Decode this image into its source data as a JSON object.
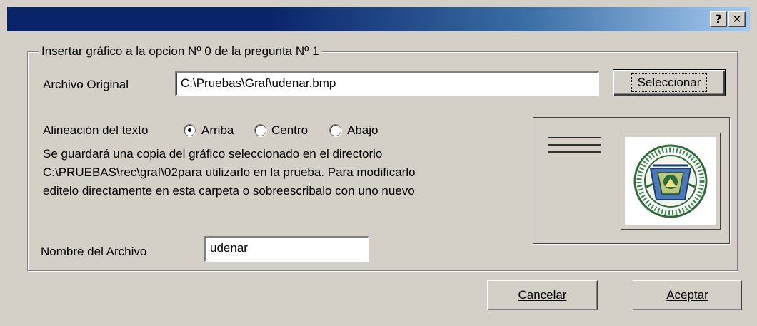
{
  "window": {
    "title": "",
    "help_label": "?",
    "close_label": "✕"
  },
  "group": {
    "legend": "Insertar gráfico a la opcion Nº 0 de la pregunta Nº 1"
  },
  "archivo_original": {
    "label": "Archivo Original",
    "value": "C:\\Pruebas\\Graf\\udenar.bmp",
    "select_button": "Seleccionar"
  },
  "alineacion": {
    "label": "Alineación del texto",
    "options": [
      "Arriba",
      "Centro",
      "Abajo"
    ],
    "selected": "Arriba"
  },
  "info_lines": [
    "Se guardará una copia del gráfico seleccionado en el directorio",
    "C:\\PRUEBAS\\rec\\graf\\02para utilizarlo en la prueba. Para modificarlo",
    "editelo directamente en esta carpeta o sobreescribalo con uno nuevo"
  ],
  "nombre": {
    "label": "Nombre del Archivo",
    "value": "udenar"
  },
  "buttons": {
    "cancel": "Cancelar",
    "accept": "Aceptar"
  },
  "colors": {
    "titlebar_start": "#0a246a",
    "titlebar_end": "#a6caf0",
    "dialog_bg": "#d4d0c8"
  },
  "icons": {
    "help": "question-mark-icon",
    "close": "close-icon",
    "preview_image": "university-seal-image"
  }
}
